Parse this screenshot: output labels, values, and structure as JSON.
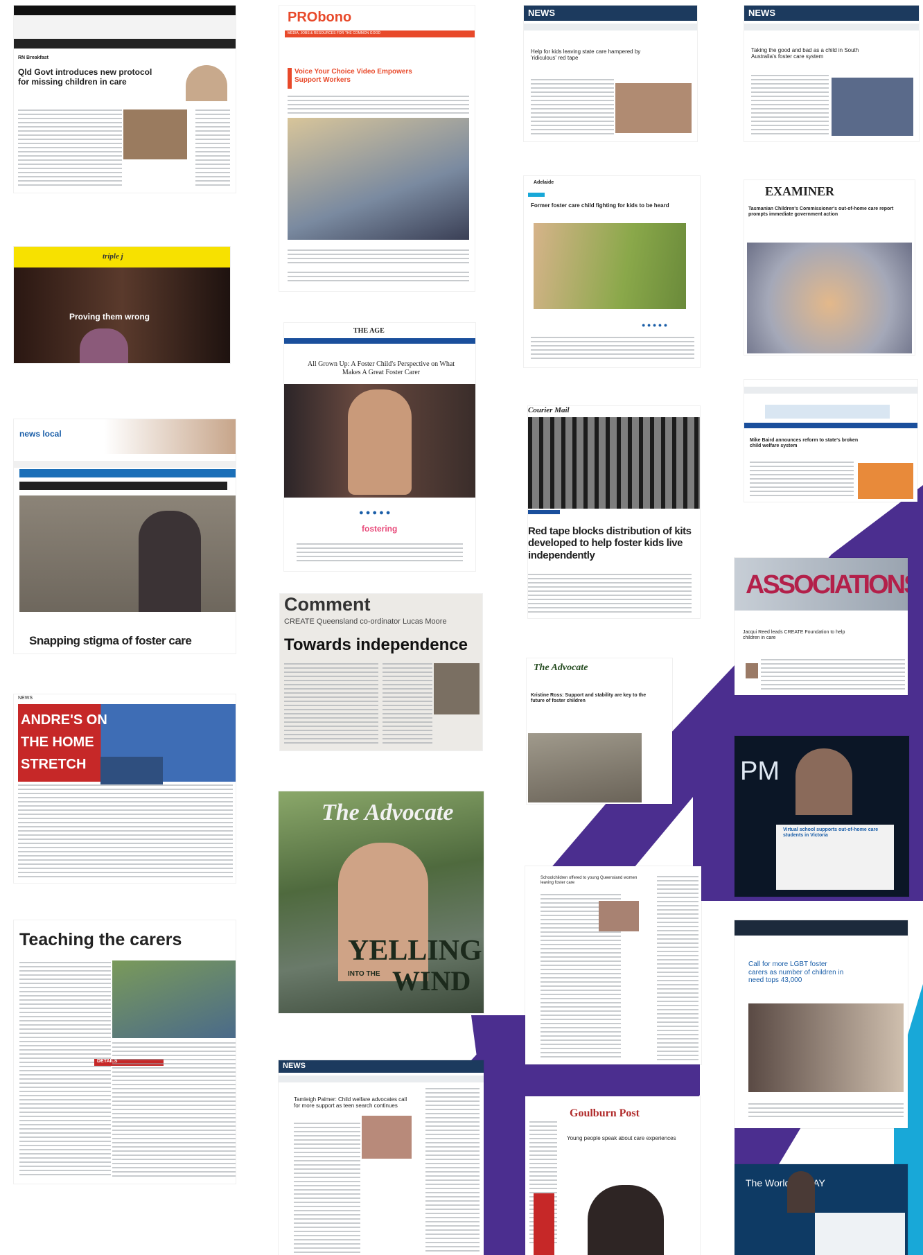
{
  "colors": {
    "purple": "#4b2e8f",
    "cyan": "#18a8d8",
    "probono_orange": "#e8492a",
    "yellow": "#f7e100",
    "dark_red": "#c62828"
  },
  "clips": {
    "abc": {
      "header": "RN Breakfast",
      "headline": "Qld Govt introduces new protocol for missing children in care"
    },
    "probono": {
      "logo": "PRObono",
      "tagline": "MEDIA, JOBS & RESOURCES FOR THE COMMON GOOD",
      "headline": "Voice Your Choice Video Empowers Support Workers"
    },
    "news1": {
      "logo": "NEWS",
      "headline": "Help for kids leaving state care hampered by 'ridiculous' red tape"
    },
    "news2": {
      "logo": "NEWS",
      "headline": "Taking the good and bad as a child in South Australia's foster care system"
    },
    "triplej": {
      "logo": "triple j",
      "headline": "Proving them wrong"
    },
    "adelaide": {
      "headline": "Former foster care child fighting for kids to be heard"
    },
    "examiner": {
      "logo": "EXAMINER",
      "headline": "Tasmanian Children's Commissioner's out-of-home care report prompts immediate government action"
    },
    "age": {
      "logo": "THE AGE",
      "headline": "All Grown Up: A Foster Child's Perspective on What Makes A Great Foster Carer",
      "brand": "fostering"
    },
    "smh": {
      "headline": "Mike Baird announces reform to state's broken child welfare system"
    },
    "newslocal": {
      "logo": "news local",
      "headline": "Snapping stigma of foster care"
    },
    "courier": {
      "logo": "Courier Mail",
      "headline": "Red tape blocks distribution of kits developed to help foster kids live independently"
    },
    "comment": {
      "kicker": "Comment",
      "subtitle": "CREATE Queensland co-ordinator Lucas Moore",
      "headline": "Towards independence"
    },
    "associations": {
      "logo": "ASSOCIATIONS",
      "headline": "Jacqui Reed leads CREATE Foundation to help children in care"
    },
    "andre": {
      "header": "NEWS",
      "headline_lines": [
        "ANDRE'S ON",
        "THE HOME",
        "STRETCH"
      ]
    },
    "advocate_web": {
      "logo": "The Advocate",
      "headline": "Kristine Ross: Support and stability are key to the future of foster children"
    },
    "advocate_print": {
      "logo": "The Advocate",
      "big1": "YELLING",
      "into": "INTO THE",
      "big2": "WIND"
    },
    "pm": {
      "logo": "PM",
      "headline": "Virtual school supports out-of-home care students in Victoria"
    },
    "teaching": {
      "headline": "Teaching the carers",
      "details": "DETAILS"
    },
    "brisbane": {
      "headline": "Schoolchildren offered to young Queensland women leaving foster care"
    },
    "news3": {
      "logo": "NEWS",
      "headline": "Tamleigh Palmer: Child welfare advocates call for more support as teen search continues"
    },
    "lgbt": {
      "headline": "Call for more LGBT foster carers as number of children in need tops 43,000"
    },
    "goulburn": {
      "logo": "Goulburn Post",
      "headline": "Young people speak about care experiences"
    },
    "worldtoday": {
      "logo": "The World TODAY"
    }
  }
}
